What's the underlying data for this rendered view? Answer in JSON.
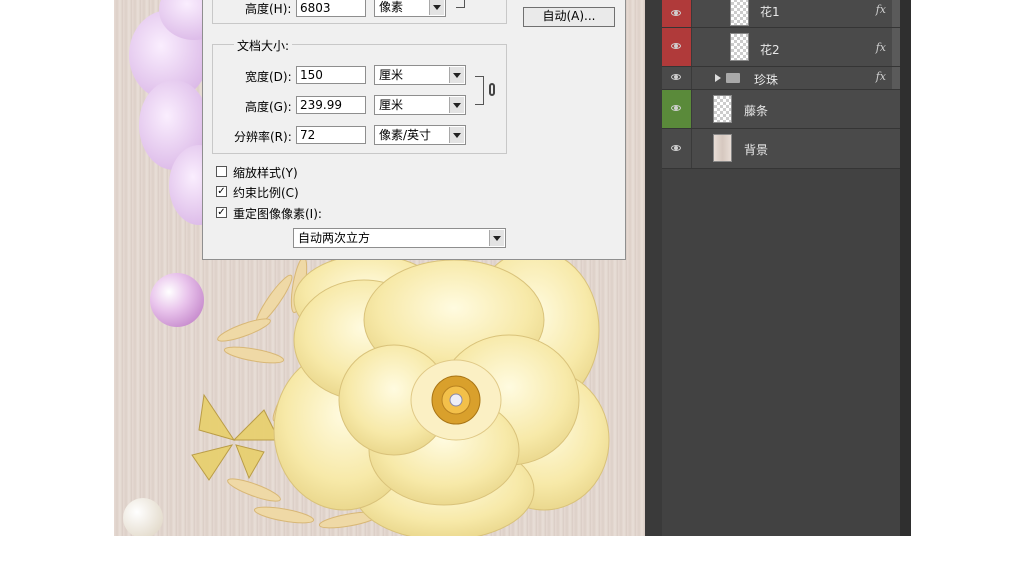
{
  "dialog": {
    "top_height": {
      "label": "高度(H):",
      "value": "6803",
      "unit": "像素"
    },
    "auto_button": "自动(A)...",
    "doc_size_title": "文档大小:",
    "width": {
      "label": "宽度(D):",
      "value": "150",
      "unit": "厘米"
    },
    "height": {
      "label": "高度(G):",
      "value": "239.99",
      "unit": "厘米"
    },
    "resolution": {
      "label": "分辨率(R):",
      "value": "72",
      "unit": "像素/英寸"
    },
    "scale_styles": {
      "label": "缩放样式(Y)",
      "checked": false
    },
    "constrain": {
      "label": "约束比例(C)",
      "checked": true
    },
    "resample": {
      "label": "重定图像像素(I):",
      "checked": true
    },
    "resample_method": "自动两次立方"
  },
  "layers": [
    {
      "name": "花1",
      "eye_color": "#b03a3a",
      "fx": "fx",
      "type": "smart"
    },
    {
      "name": "花2",
      "eye_color": "#b03a3a",
      "fx": "fx",
      "type": "smart"
    },
    {
      "name": "珍珠",
      "eye_color": "#555555",
      "fx": "fx",
      "type": "group"
    },
    {
      "name": "藤条",
      "eye_color": "#5a8a3a",
      "fx": "",
      "type": "layer"
    },
    {
      "name": "背景",
      "eye_color": "#4a4a4a",
      "fx": "",
      "type": "background"
    }
  ],
  "colors": {
    "panel_bg": "#424242",
    "dialog_bg": "#f0f0f0",
    "red_tag": "#b03a3a",
    "green_tag": "#5a8a3a"
  }
}
